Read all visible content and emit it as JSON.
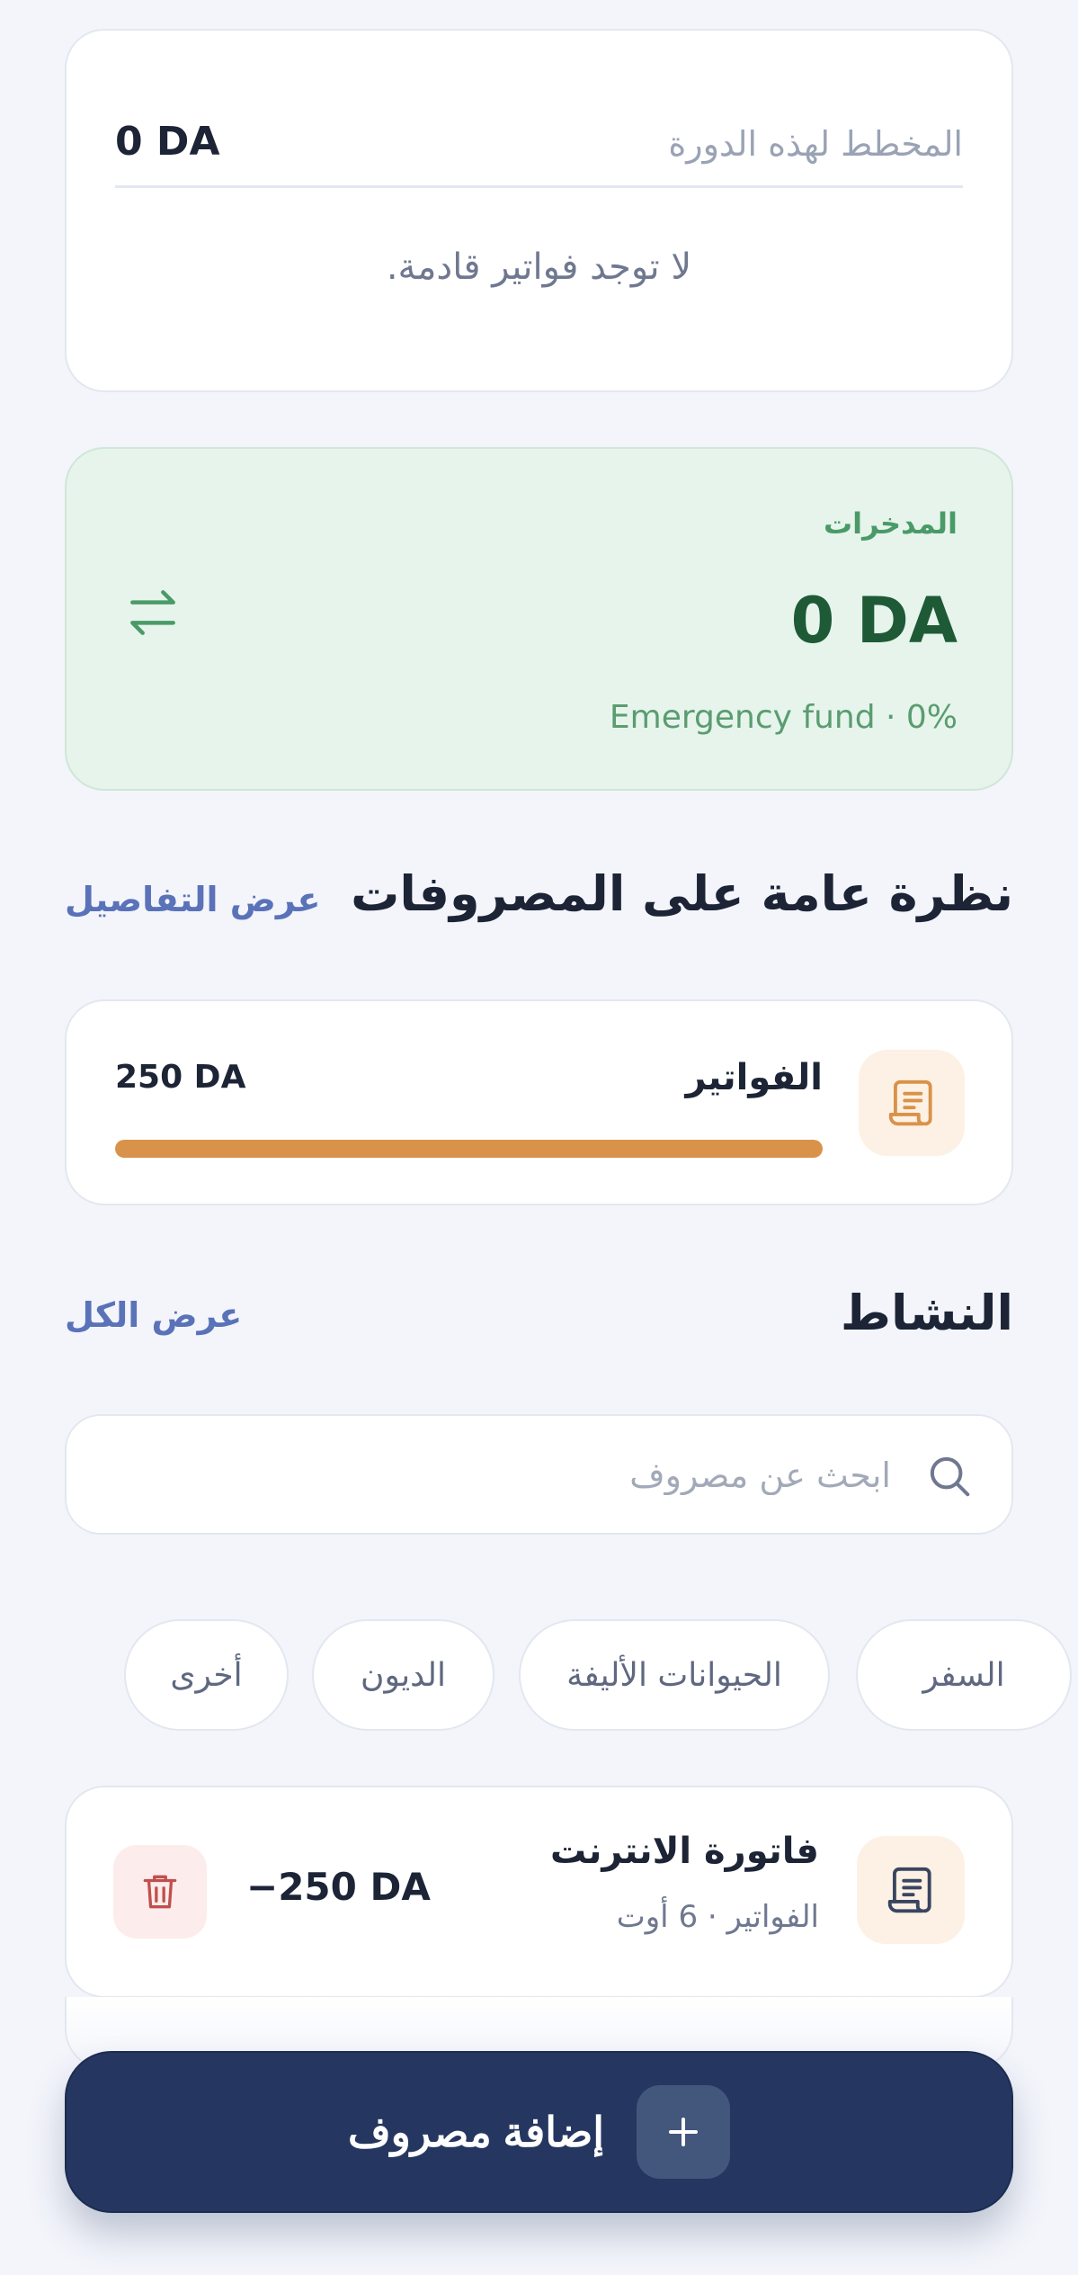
{
  "planned": {
    "label": "المخطط لهذه الدورة",
    "amount": "0 DA",
    "empty_text": "لا توجد فواتير قادمة."
  },
  "savings": {
    "label": "المدخرات",
    "amount": "0 DA",
    "subtitle": "Emergency fund · 0%"
  },
  "overview": {
    "title": "نظرة عامة على المصروفات",
    "link": "عرض التفاصيل",
    "items": [
      {
        "name": "الفواتير",
        "amount": "250 DA",
        "progress_percent": 100,
        "color": "#d9924a",
        "icon": "receipt-icon"
      }
    ]
  },
  "activity": {
    "title": "النشاط",
    "link": "عرض الكل",
    "search_placeholder": "ابحث عن مصروف",
    "chips": [
      "السفر",
      "الحيوانات الأليفة",
      "الديون",
      "أخرى"
    ],
    "transactions": [
      {
        "name": "فاتورة الانترنت",
        "meta": "الفواتير · 6 أوت",
        "amount": "−250 DA",
        "icon": "receipt-icon"
      }
    ]
  },
  "add_button": {
    "label": "إضافة مصروف",
    "icon": "plus-icon"
  },
  "colors": {
    "accent": "#253760",
    "link": "#5a72b8",
    "savings_bg": "#e6f4ec",
    "savings_text": "#1e5a36",
    "bills": "#d9924a",
    "danger": "#c0504d"
  }
}
